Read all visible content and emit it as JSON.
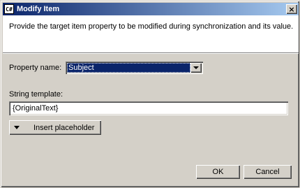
{
  "window": {
    "title": "Modify Item",
    "icon_label": "C#",
    "close_label": "×"
  },
  "banner": {
    "description": "Provide the target item property to be modified during synchronization and its value."
  },
  "form": {
    "property_label": "Property name:",
    "property_value": "Subject",
    "template_label": "String template:",
    "template_value": "{OriginalText}",
    "insert_label": "Insert placeholder"
  },
  "footer": {
    "ok_label": "OK",
    "cancel_label": "Cancel"
  },
  "colors": {
    "title_start": "#0a246a",
    "title_end": "#a6caf0",
    "selection": "#0a246a",
    "face": "#d4d0c8"
  }
}
